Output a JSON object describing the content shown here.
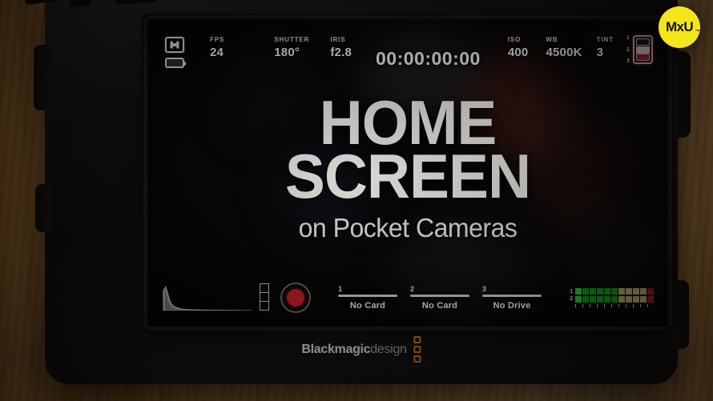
{
  "brand_badge": {
    "label": "MxU",
    "tm": "™",
    "color": "#f5e619"
  },
  "title": {
    "line1": "HOME",
    "line2": "SCREEN",
    "subtitle": "on Pocket Cameras"
  },
  "camera": {
    "manufacturer_bold": "Blackmagic",
    "manufacturer_light": "design",
    "logo_color": "#e07820"
  },
  "hud": {
    "top": {
      "frameguide_icon": "frame-guide-icon",
      "battery_icon": "battery-icon",
      "stats": [
        {
          "key": "FPS",
          "value": "24"
        },
        {
          "key": "SHUTTER",
          "value": "180°"
        },
        {
          "key": "IRIS",
          "value": "f2.8"
        }
      ],
      "timecode": "00:00:00:00",
      "stats_right": [
        {
          "key": "ISO",
          "value": "400"
        },
        {
          "key": "WB",
          "value": "4500K"
        },
        {
          "key": "TINT",
          "value": "3"
        }
      ],
      "media_icon": "media-slots-icon",
      "media_rows": [
        "1",
        "2",
        "3"
      ],
      "settings_icon": "settings-sliders-icon"
    },
    "bottom": {
      "histogram_icon": "histogram",
      "zebra_scale_icon": "exposure-scale-icon",
      "record_button": "record-button",
      "slots": [
        {
          "num": "1",
          "label": "No Card"
        },
        {
          "num": "2",
          "label": "No Card"
        },
        {
          "num": "3",
          "label": "No Drive"
        }
      ],
      "audio_channels": [
        "1",
        "2"
      ],
      "audio_meter_segments": [
        "gl",
        "g",
        "g",
        "g",
        "g",
        "g",
        "y",
        "y",
        "y",
        "y",
        "r"
      ],
      "audio_colors": {
        "green": "#15a51d",
        "green_light": "#34d93c",
        "yellow": "#c9bd7a",
        "red": "#bb1228"
      }
    }
  }
}
